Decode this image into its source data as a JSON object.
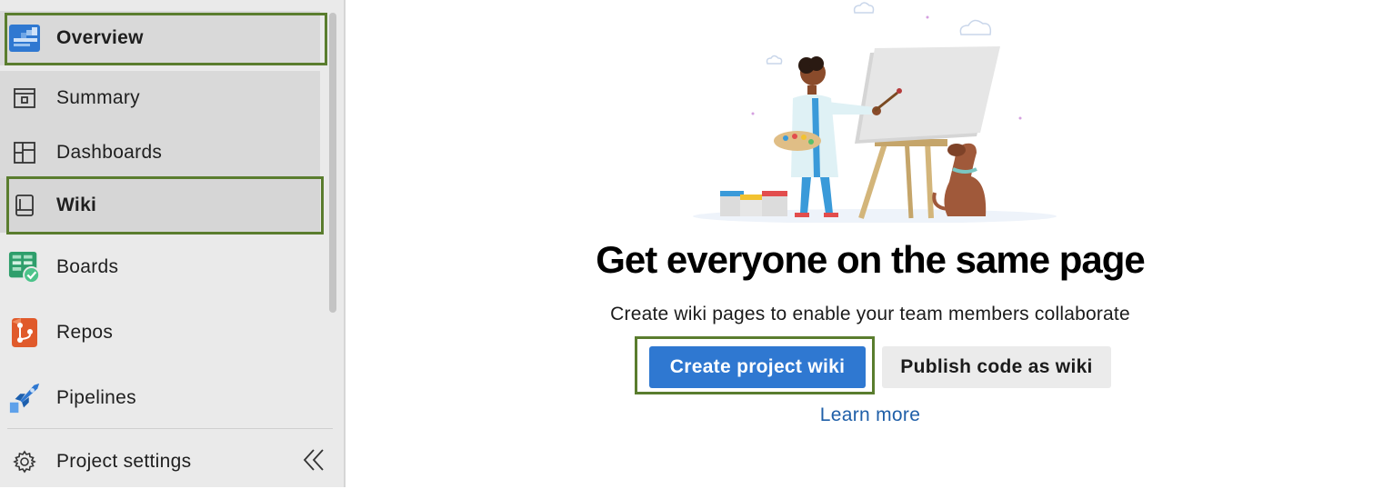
{
  "sidebar": {
    "items": [
      {
        "label": "Overview",
        "icon": "overview-icon"
      },
      {
        "label": "Summary",
        "icon": "summary-icon"
      },
      {
        "label": "Dashboards",
        "icon": "dashboards-icon"
      },
      {
        "label": "Wiki",
        "icon": "wiki-icon"
      },
      {
        "label": "Boards",
        "icon": "boards-icon"
      },
      {
        "label": "Repos",
        "icon": "repos-icon"
      },
      {
        "label": "Pipelines",
        "icon": "pipelines-icon"
      }
    ],
    "settings_label": "Project settings",
    "collapse_icon": "double-chevron-left-icon"
  },
  "main": {
    "illustration": "painter-with-easel-and-dog",
    "headline": "Get everyone on the same page",
    "subtitle": "Create wiki pages to enable your team members collaborate",
    "primary_button": "Create project wiki",
    "secondary_button": "Publish code as wiki",
    "link": "Learn more"
  },
  "colors": {
    "highlight": "#5a7d2e",
    "primary": "#2f78d1",
    "link": "#1f5fa8",
    "sidebar_bg": "#eaeaea"
  }
}
